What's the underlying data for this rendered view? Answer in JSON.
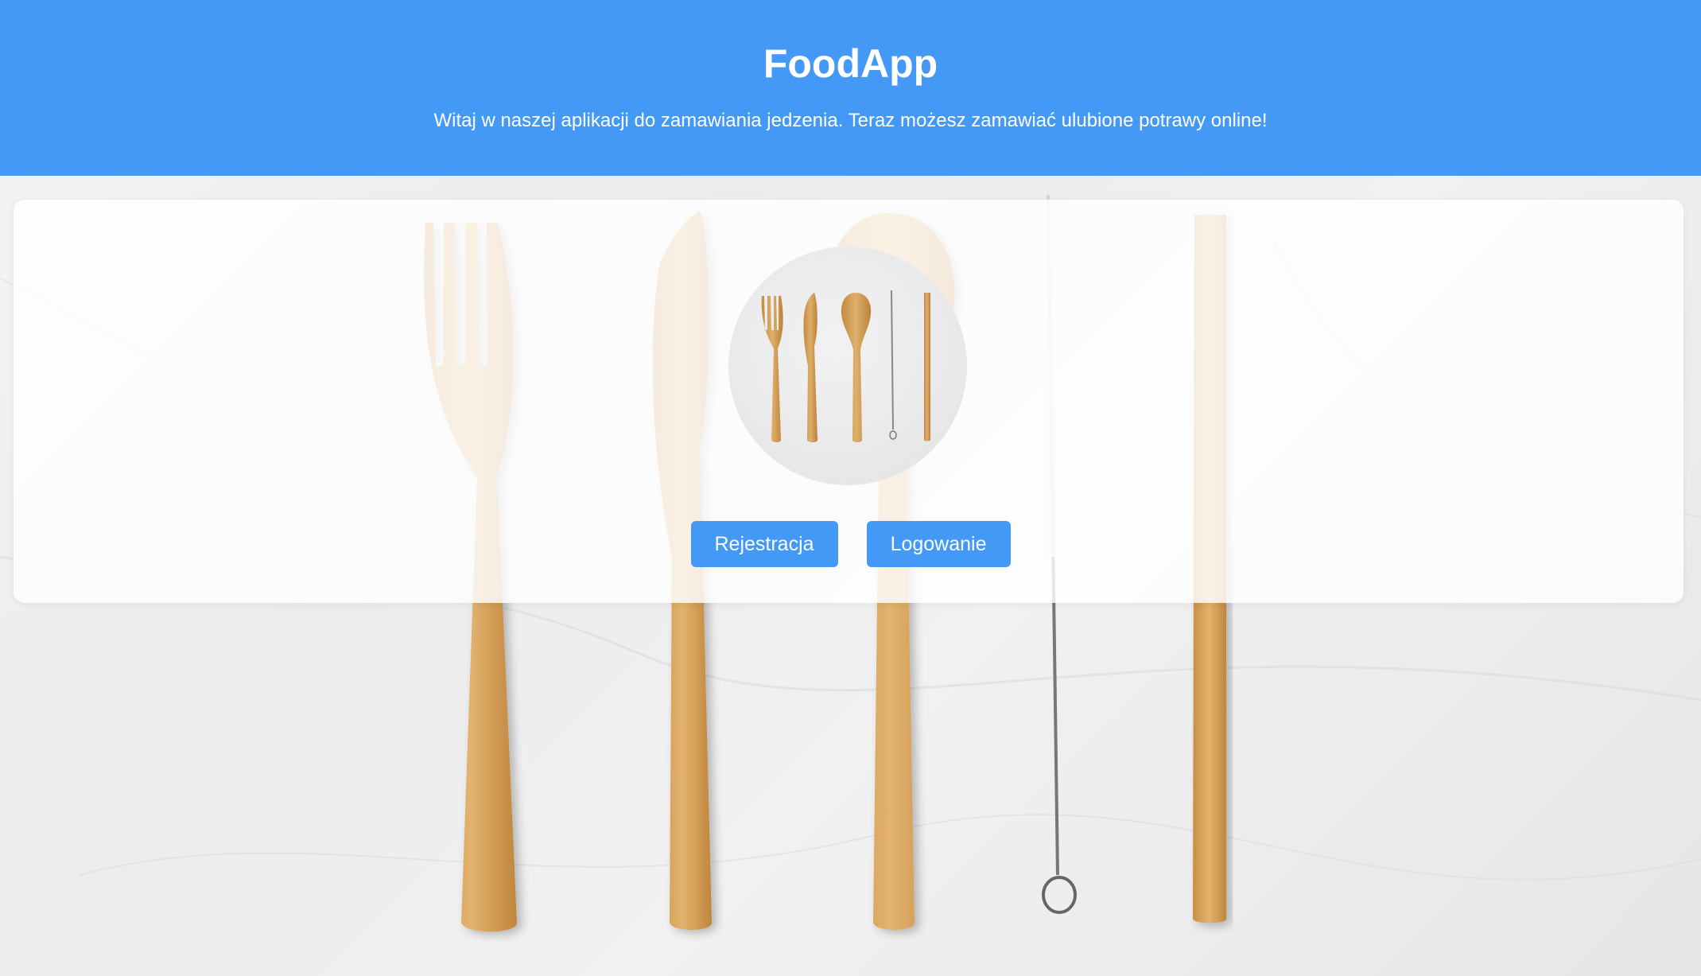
{
  "app": {
    "title": "FoodApp",
    "subtitle": "Witaj w naszej aplikacji do zamawiania jedzenia. Teraz możesz zamawiać ulubione potrawy online!"
  },
  "actions": {
    "register_label": "Rejestracja",
    "login_label": "Logowanie"
  },
  "images": {
    "background": "bamboo-cutlery-set-photo",
    "logo": "bamboo-cutlery-logo-icon"
  },
  "colors": {
    "primary": "#4499f7",
    "header_text": "#ffffff",
    "card_background": "rgba(255,255,255,0.82)",
    "bamboo": "#d9a864"
  }
}
